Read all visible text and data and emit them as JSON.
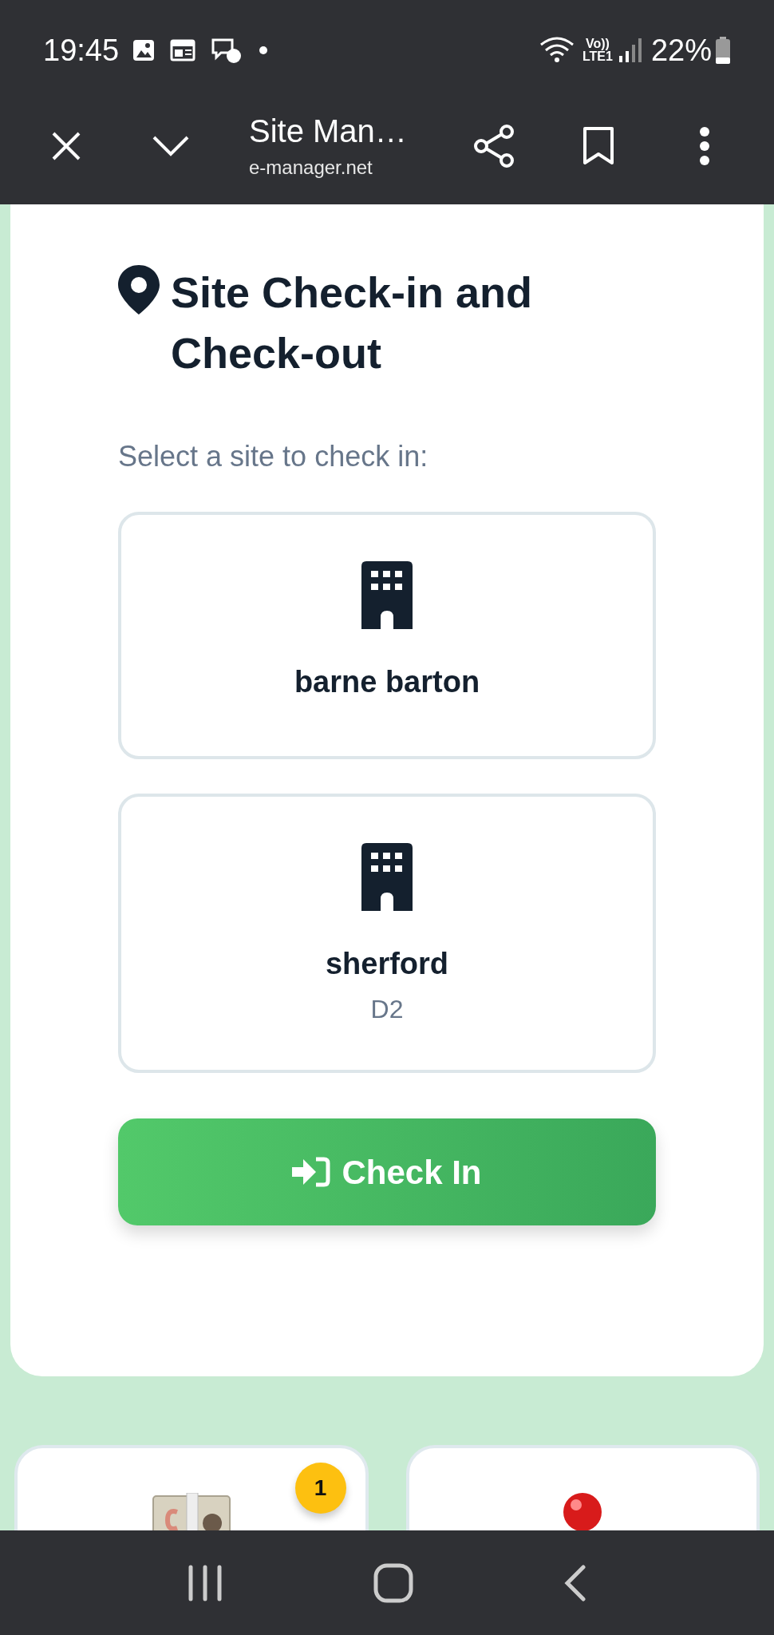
{
  "status_bar": {
    "time": "19:45",
    "network_labels": [
      "Vo))",
      "LTE1"
    ],
    "battery": "22%"
  },
  "browser_bar": {
    "title": "Site Man…",
    "url": "e-manager.net"
  },
  "heading": "Site Check-in and Check-out",
  "prompt": "Select a site to check in:",
  "sites": [
    {
      "name": "barne barton",
      "selected": false
    },
    {
      "name": "sherford",
      "detail": "D2",
      "selected": false
    }
  ],
  "check_in_button": {
    "label": "Check In"
  },
  "tiles": [
    {
      "kind": "cash",
      "badge": "1"
    },
    {
      "kind": "pin"
    }
  ]
}
